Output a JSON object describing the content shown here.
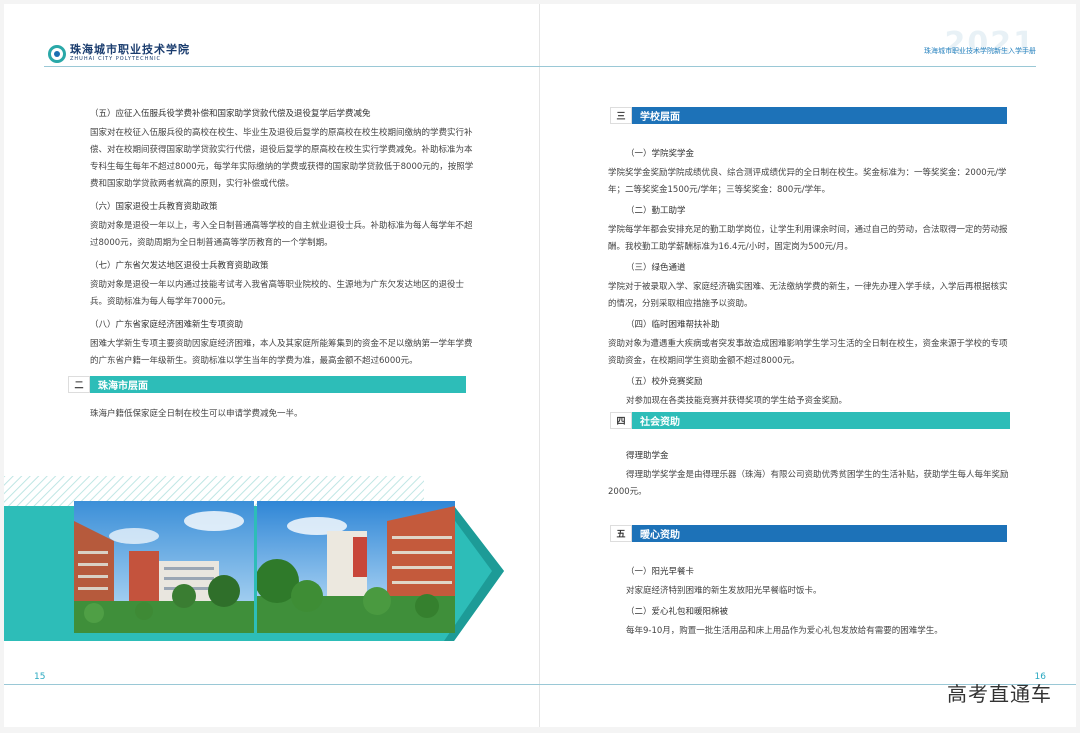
{
  "header": {
    "school_name_cn": "珠海城市职业技术学院",
    "school_name_en": "ZHUHAI CITY POLYTECHNIC",
    "handbook_title": "珠海城市职业技术学院新生入学手册",
    "year": "2021"
  },
  "left_page": {
    "items": [
      {
        "title": "（五）应征入伍服兵役学费补偿和国家助学贷款代偿及退役复学后学费减免",
        "text": "国家对在校征入伍服兵役的高校在校生、毕业生及退役后复学的原高校在校生校期间缴纳的学费实行补偿、对在校期间获得国家助学贷款实行代偿，退役后复学的原高校在校生实行学费减免。补助标准为本专科生每生每年不超过8000元，每学年实际缴纳的学费或获得的国家助学贷款低于8000元的，按照学费和国家助学贷款两者就高的原则，实行补偿或代偿。"
      },
      {
        "title": "（六）国家退役士兵教育资助政策",
        "text": "资助对象是退役一年以上，考入全日制普通高等学校的自主就业退役士兵。补助标准为每人每学年不超过8000元，资助周期为全日制普通高等学历教育的一个学制期。"
      },
      {
        "title": "（七）广东省欠发达地区退役士兵教育资助政策",
        "text": "资助对象是退役一年以内通过技能考试考入我省高等职业院校的、生源地为广东欠发达地区的退役士兵。资助标准为每人每学年7000元。"
      },
      {
        "title": "（八）广东省家庭经济困难新生专项资助",
        "text": "困难大学新生专项主要资助因家庭经济困难，本人及其家庭所能筹集到的资金不足以缴纳第一学年学费的广东省户籍一年级新生。资助标准以学生当年的学费为准，最高金额不超过6000元。"
      }
    ],
    "section2": {
      "num": "二",
      "title": "珠海市层面",
      "text": "珠海户籍低保家庭全日制在校生可以申请学费减免一半。"
    },
    "page_number": "15"
  },
  "right_page": {
    "section3": {
      "num": "三",
      "title": "学校层面",
      "items": [
        {
          "title": "（一）学院奖学金",
          "text": "学院奖学金奖励学院成绩优良、综合测评成绩优异的全日制在校生。奖金标准为：一等奖奖金：2000元/学年；二等奖奖金1500元/学年；三等奖奖金：800元/学年。"
        },
        {
          "title": "（二）勤工助学",
          "text": "学院每学年都会安排充足的勤工助学岗位，让学生利用课余时间，通过自己的劳动，合法取得一定的劳动报酬。我校勤工助学薪酬标准为16.4元/小时，固定岗为500元/月。"
        },
        {
          "title": "（三）绿色通道",
          "text": "学院对于被录取入学、家庭经济确实困难、无法缴纳学费的新生，一律先办理入学手续，入学后再根据核实的情况，分别采取相应措施予以资助。"
        },
        {
          "title": "（四）临时困难帮扶补助",
          "text": "资助对象为遭遇重大疾病或者突发事故造成困难影响学生学习生活的全日制在校生，资金来源于学校的专项资助资金，在校期间学生资助金额不超过8000元。"
        },
        {
          "title": "（五）校外竞赛奖励",
          "text": "对参加现在各类技能竞赛并获得奖项的学生给予资金奖励。"
        }
      ]
    },
    "section4": {
      "num": "四",
      "title": "社会资助",
      "items": [
        {
          "title": "得理助学金",
          "text": "得理助学奖学金是由得理乐器（珠海）有限公司资助优秀贫困学生的生活补贴，获助学生每人每年奖励2000元。"
        }
      ]
    },
    "section5": {
      "num": "五",
      "title": "暖心资助",
      "items": [
        {
          "title": "（一）阳光早餐卡",
          "text": "对家庭经济特别困难的新生发放阳光早餐临时饭卡。"
        },
        {
          "title": "（二）爱心礼包和暖阳棉被",
          "text": "每年9-10月，购置一批生活用品和床上用品作为爱心礼包发放给有需要的困难学生。"
        }
      ]
    },
    "page_number": "16"
  },
  "watermark": "高考直通车",
  "colors": {
    "teal": "#2dbdb8",
    "blue": "#1d72b8",
    "navy": "#1a3c6e"
  }
}
